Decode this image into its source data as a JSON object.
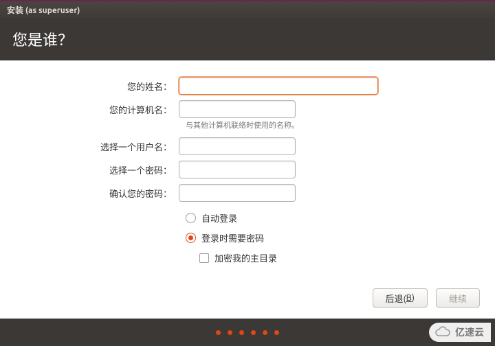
{
  "titlebar": {
    "text": "安装 (as superuser)"
  },
  "header": {
    "title": "您是谁？"
  },
  "form": {
    "name": {
      "label": "您的姓名：",
      "value": ""
    },
    "hostname": {
      "label": "您的计算机名：",
      "value": "",
      "hint": "与其他计算机联络时使用的名称。"
    },
    "username": {
      "label": "选择一个用户名：",
      "value": ""
    },
    "password": {
      "label": "选择一个密码：",
      "value": ""
    },
    "confirm": {
      "label": "确认您的密码：",
      "value": ""
    }
  },
  "options": {
    "auto_login": {
      "label": "自动登录",
      "selected": false
    },
    "require_password": {
      "label": "登录时需要密码",
      "selected": true
    },
    "encrypt_home": {
      "label": "加密我的主目录",
      "checked": false
    }
  },
  "buttons": {
    "back": {
      "label_pre": "后退(",
      "label_key": "B",
      "label_post": ")"
    },
    "continue": {
      "label": "继续",
      "disabled": true
    }
  },
  "watermark": {
    "text": "亿速云"
  }
}
